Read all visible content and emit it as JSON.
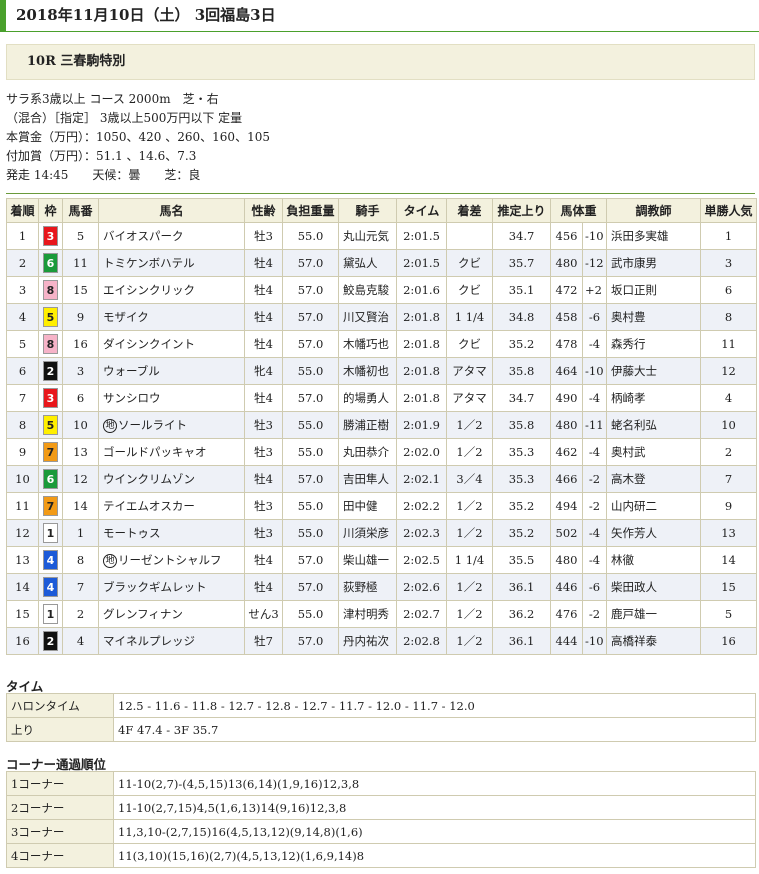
{
  "header": {
    "title": "2018年11月10日（土） 3回福島3日"
  },
  "race": {
    "name": "10R 三春駒特別"
  },
  "conditions": {
    "line1": "サラ系3歳以上 コース 2000m　芝・右",
    "line2": "（混合）［指定］ 3歳以上500万円以下 定量",
    "line3": "本賞金（万円）：1050、420 、260、160、105",
    "line4": "付加賞（万円）：51.1 、14.6、7.3",
    "line5": "発走 14:45　　天候：曇　　芝：良"
  },
  "columns": [
    "着順",
    "枠",
    "馬番",
    "馬名",
    "性齢",
    "負担重量",
    "騎手",
    "タイム",
    "着差",
    "推定上り",
    "馬体重",
    "",
    "調教師",
    "単勝人気"
  ],
  "waku_colors": {
    "1": {
      "bg": "#ffffff",
      "fg": "#222222"
    },
    "2": {
      "bg": "#111111",
      "fg": "#ffffff"
    },
    "3": {
      "bg": "#e8161b",
      "fg": "#ffffff"
    },
    "4": {
      "bg": "#1c5ad8",
      "fg": "#ffffff"
    },
    "5": {
      "bg": "#ffef00",
      "fg": "#222222"
    },
    "6": {
      "bg": "#1a9a3a",
      "fg": "#ffffff"
    },
    "7": {
      "bg": "#f29a16",
      "fg": "#222222"
    },
    "8": {
      "bg": "#f6b3c8",
      "fg": "#222222"
    }
  },
  "rows": [
    {
      "pos": "1",
      "waku": "3",
      "num": "5",
      "chi": "",
      "name": "バイオスパーク",
      "sex": "牡3",
      "wt": "55.0",
      "jockey": "丸山元気",
      "time": "2:01.5",
      "margin": "",
      "agari": "34.7",
      "bw": "456",
      "diff": "-10",
      "trainer": "浜田多実雄",
      "pop": "1"
    },
    {
      "pos": "2",
      "waku": "6",
      "num": "11",
      "chi": "",
      "name": "トミケンボハテル",
      "sex": "牡4",
      "wt": "57.0",
      "jockey": "黛弘人",
      "time": "2:01.5",
      "margin": "クビ",
      "agari": "35.7",
      "bw": "480",
      "diff": "-12",
      "trainer": "武市康男",
      "pop": "3"
    },
    {
      "pos": "3",
      "waku": "8",
      "num": "15",
      "chi": "",
      "name": "エイシンクリック",
      "sex": "牡4",
      "wt": "57.0",
      "jockey": "鮫島克駿",
      "time": "2:01.6",
      "margin": "クビ",
      "agari": "35.1",
      "bw": "472",
      "diff": "+2",
      "trainer": "坂口正則",
      "pop": "6"
    },
    {
      "pos": "4",
      "waku": "5",
      "num": "9",
      "chi": "",
      "name": "モザイク",
      "sex": "牡4",
      "wt": "57.0",
      "jockey": "川又賢治",
      "time": "2:01.8",
      "margin": "1 1/4",
      "agari": "34.8",
      "bw": "458",
      "diff": "-6",
      "trainer": "奥村豊",
      "pop": "8"
    },
    {
      "pos": "5",
      "waku": "8",
      "num": "16",
      "chi": "",
      "name": "ダイシンクイント",
      "sex": "牡4",
      "wt": "57.0",
      "jockey": "木幡巧也",
      "time": "2:01.8",
      "margin": "クビ",
      "agari": "35.2",
      "bw": "478",
      "diff": "-4",
      "trainer": "森秀行",
      "pop": "11"
    },
    {
      "pos": "6",
      "waku": "2",
      "num": "3",
      "chi": "",
      "name": "ウォーブル",
      "sex": "牝4",
      "wt": "55.0",
      "jockey": "木幡初也",
      "time": "2:01.8",
      "margin": "アタマ",
      "agari": "35.8",
      "bw": "464",
      "diff": "-10",
      "trainer": "伊藤大士",
      "pop": "12"
    },
    {
      "pos": "7",
      "waku": "3",
      "num": "6",
      "chi": "",
      "name": "サンシロウ",
      "sex": "牡4",
      "wt": "57.0",
      "jockey": "的場勇人",
      "time": "2:01.8",
      "margin": "アタマ",
      "agari": "34.7",
      "bw": "490",
      "diff": "-4",
      "trainer": "柄崎孝",
      "pop": "4"
    },
    {
      "pos": "8",
      "waku": "5",
      "num": "10",
      "chi": "地",
      "name": "ソールライト",
      "sex": "牡3",
      "wt": "55.0",
      "jockey": "勝浦正樹",
      "time": "2:01.9",
      "margin": "1／2",
      "agari": "35.8",
      "bw": "480",
      "diff": "-11",
      "trainer": "蛯名利弘",
      "pop": "10"
    },
    {
      "pos": "9",
      "waku": "7",
      "num": "13",
      "chi": "",
      "name": "ゴールドパッキャオ",
      "sex": "牡3",
      "wt": "55.0",
      "jockey": "丸田恭介",
      "time": "2:02.0",
      "margin": "1／2",
      "agari": "35.3",
      "bw": "462",
      "diff": "-4",
      "trainer": "奥村武",
      "pop": "2"
    },
    {
      "pos": "10",
      "waku": "6",
      "num": "12",
      "chi": "",
      "name": "ウインクリムゾン",
      "sex": "牡4",
      "wt": "57.0",
      "jockey": "吉田隼人",
      "time": "2:02.1",
      "margin": "3／4",
      "agari": "35.3",
      "bw": "466",
      "diff": "-2",
      "trainer": "高木登",
      "pop": "7"
    },
    {
      "pos": "11",
      "waku": "7",
      "num": "14",
      "chi": "",
      "name": "テイエムオスカー",
      "sex": "牡3",
      "wt": "55.0",
      "jockey": "田中健",
      "time": "2:02.2",
      "margin": "1／2",
      "agari": "35.2",
      "bw": "494",
      "diff": "-2",
      "trainer": "山内研二",
      "pop": "9"
    },
    {
      "pos": "12",
      "waku": "1",
      "num": "1",
      "chi": "",
      "name": "モートゥス",
      "sex": "牡3",
      "wt": "55.0",
      "jockey": "川須栄彦",
      "time": "2:02.3",
      "margin": "1／2",
      "agari": "35.2",
      "bw": "502",
      "diff": "-4",
      "trainer": "矢作芳人",
      "pop": "13"
    },
    {
      "pos": "13",
      "waku": "4",
      "num": "8",
      "chi": "地",
      "name": "リーゼントシャルフ",
      "sex": "牡4",
      "wt": "57.0",
      "jockey": "柴山雄一",
      "time": "2:02.5",
      "margin": "1 1/4",
      "agari": "35.5",
      "bw": "480",
      "diff": "-4",
      "trainer": "林徹",
      "pop": "14"
    },
    {
      "pos": "14",
      "waku": "4",
      "num": "7",
      "chi": "",
      "name": "ブラックギムレット",
      "sex": "牡4",
      "wt": "57.0",
      "jockey": "荻野極",
      "time": "2:02.6",
      "margin": "1／2",
      "agari": "36.1",
      "bw": "446",
      "diff": "-6",
      "trainer": "柴田政人",
      "pop": "15"
    },
    {
      "pos": "15",
      "waku": "1",
      "num": "2",
      "chi": "",
      "name": "グレンフィナン",
      "sex": "せん3",
      "wt": "55.0",
      "jockey": "津村明秀",
      "time": "2:02.7",
      "margin": "1／2",
      "agari": "36.2",
      "bw": "476",
      "diff": "-2",
      "trainer": "鹿戸雄一",
      "pop": "5"
    },
    {
      "pos": "16",
      "waku": "2",
      "num": "4",
      "chi": "",
      "name": "マイネルプレッジ",
      "sex": "牡7",
      "wt": "57.0",
      "jockey": "丹内祐次",
      "time": "2:02.8",
      "margin": "1／2",
      "agari": "36.1",
      "bw": "444",
      "diff": "-10",
      "trainer": "高橋祥泰",
      "pop": "16"
    }
  ],
  "time_section": {
    "title": "タイム",
    "rows": [
      {
        "label": "ハロンタイム",
        "value": "12.5 - 11.6 - 11.8 - 12.7 - 12.8 - 12.7 - 11.7 - 12.0 - 11.7 - 12.0"
      },
      {
        "label": "上り",
        "value": "4F 47.4 - 3F 35.7"
      }
    ]
  },
  "corner_section": {
    "title": "コーナー通過順位",
    "rows": [
      {
        "label": "1コーナー",
        "value": "11-10(2,7)-(4,5,15)13(6,14)(1,9,16)12,3,8"
      },
      {
        "label": "2コーナー",
        "value": "11-10(2,7,15)4,5(1,6,13)14(9,16)12,3,8"
      },
      {
        "label": "3コーナー",
        "value": "11,3,10-(2,7,15)16(4,5,13,12)(9,14,8)(1,6)"
      },
      {
        "label": "4コーナー",
        "value": "11(3,10)(15,16)(2,7)(4,5,13,12)(1,6,9,14)8"
      }
    ]
  }
}
